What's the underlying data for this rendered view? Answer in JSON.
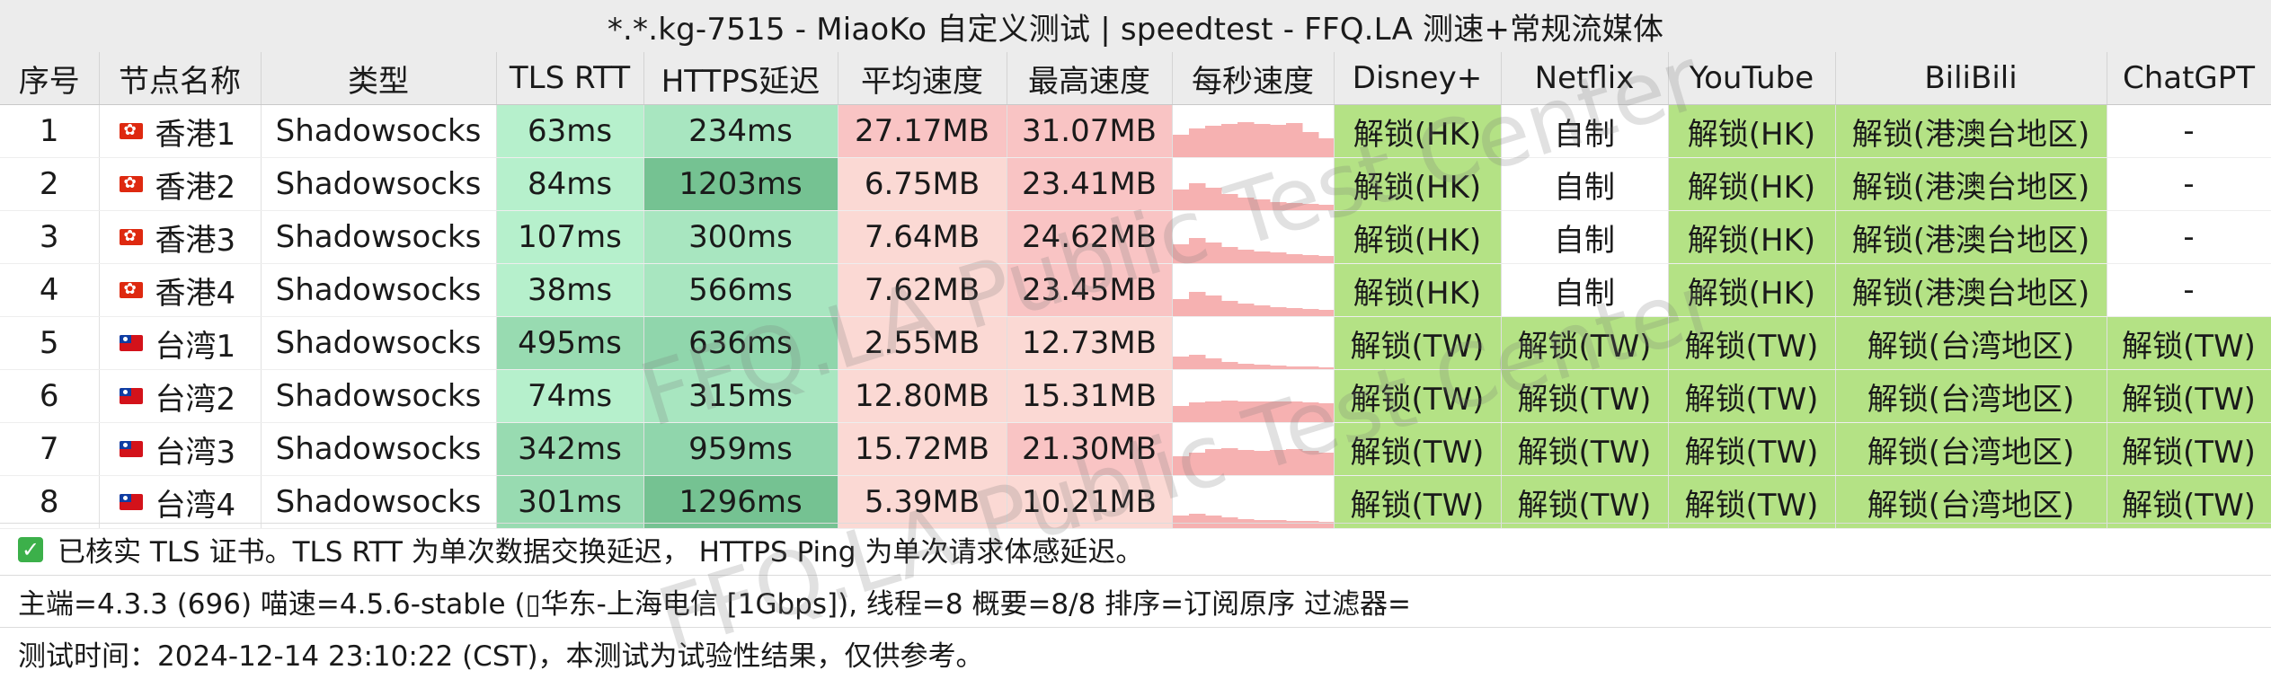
{
  "window": {
    "title": "*.*.kg-7515 - MiaoKo 自定义测试 | speedtest - FFQ.LA 测速+常规流媒体"
  },
  "table": {
    "columns": [
      "序号",
      "节点名称",
      "类型",
      "TLS RTT",
      "HTTPS延迟",
      "平均速度",
      "最高速度",
      "每秒速度",
      "Disney+",
      "Netflix",
      "YouTube",
      "BiliBili",
      "ChatGPT"
    ],
    "rows": [
      {
        "index": "1",
        "flag": "hk-flag-icon",
        "name": "香港1",
        "type": "Shadowsocks",
        "tls_rtt": "63ms",
        "https": "234ms",
        "avg": "27.17MB",
        "max": "31.07MB",
        "speed_trace": [
          0.55,
          0.7,
          0.75,
          0.8,
          0.85,
          0.8,
          0.78,
          0.82,
          0.6,
          0.45
        ],
        "disney": "解锁(HK)",
        "netflix": "自制",
        "youtube": "解锁(HK)",
        "bilibili": "解锁(港澳台地区)",
        "chatgpt": "-"
      },
      {
        "index": "2",
        "flag": "hk-flag-icon",
        "name": "香港2",
        "type": "Shadowsocks",
        "tls_rtt": "84ms",
        "https": "1203ms",
        "avg": "6.75MB",
        "max": "23.41MB",
        "speed_trace": [
          0.5,
          0.65,
          0.55,
          0.4,
          0.3,
          0.25,
          0.2,
          0.18,
          0.15,
          0.12
        ],
        "disney": "解锁(HK)",
        "netflix": "自制",
        "youtube": "解锁(HK)",
        "bilibili": "解锁(港澳台地区)",
        "chatgpt": "-"
      },
      {
        "index": "3",
        "flag": "hk-flag-icon",
        "name": "香港3",
        "type": "Shadowsocks",
        "tls_rtt": "107ms",
        "https": "300ms",
        "avg": "7.64MB",
        "max": "24.62MB",
        "speed_trace": [
          0.45,
          0.6,
          0.5,
          0.4,
          0.32,
          0.28,
          0.25,
          0.22,
          0.2,
          0.18
        ],
        "disney": "解锁(HK)",
        "netflix": "自制",
        "youtube": "解锁(HK)",
        "bilibili": "解锁(港澳台地区)",
        "chatgpt": "-"
      },
      {
        "index": "4",
        "flag": "hk-flag-icon",
        "name": "香港4",
        "type": "Shadowsocks",
        "tls_rtt": "38ms",
        "https": "566ms",
        "avg": "7.62MB",
        "max": "23.45MB",
        "speed_trace": [
          0.42,
          0.58,
          0.5,
          0.38,
          0.3,
          0.26,
          0.22,
          0.2,
          0.18,
          0.16
        ],
        "disney": "解锁(HK)",
        "netflix": "自制",
        "youtube": "解锁(HK)",
        "bilibili": "解锁(港澳台地区)",
        "chatgpt": "-"
      },
      {
        "index": "5",
        "flag": "tw-flag-icon",
        "name": "台湾1",
        "type": "Shadowsocks",
        "tls_rtt": "495ms",
        "https": "636ms",
        "avg": "2.55MB",
        "max": "12.73MB",
        "speed_trace": [
          0.3,
          0.35,
          0.25,
          0.18,
          0.12,
          0.1,
          0.08,
          0.07,
          0.06,
          0.05
        ],
        "disney": "解锁(TW)",
        "netflix": "解锁(TW)",
        "youtube": "解锁(TW)",
        "bilibili": "解锁(台湾地区)",
        "chatgpt": "解锁(TW)"
      },
      {
        "index": "6",
        "flag": "tw-flag-icon",
        "name": "台湾2",
        "type": "Shadowsocks",
        "tls_rtt": "74ms",
        "https": "315ms",
        "avg": "12.80MB",
        "max": "15.31MB",
        "speed_trace": [
          0.4,
          0.48,
          0.5,
          0.52,
          0.5,
          0.49,
          0.51,
          0.5,
          0.48,
          0.46
        ],
        "disney": "解锁(TW)",
        "netflix": "解锁(TW)",
        "youtube": "解锁(TW)",
        "bilibili": "解锁(台湾地区)",
        "chatgpt": "解锁(TW)"
      },
      {
        "index": "7",
        "flag": "tw-flag-icon",
        "name": "台湾3",
        "type": "Shadowsocks",
        "tls_rtt": "342ms",
        "https": "959ms",
        "avg": "15.72MB",
        "max": "21.30MB",
        "speed_trace": [
          0.45,
          0.55,
          0.62,
          0.65,
          0.6,
          0.58,
          0.6,
          0.62,
          0.58,
          0.55
        ],
        "disney": "解锁(TW)",
        "netflix": "解锁(TW)",
        "youtube": "解锁(TW)",
        "bilibili": "解锁(台湾地区)",
        "chatgpt": "解锁(TW)"
      },
      {
        "index": "8",
        "flag": "tw-flag-icon",
        "name": "台湾4",
        "type": "Shadowsocks",
        "tls_rtt": "301ms",
        "https": "1296ms",
        "avg": "5.39MB",
        "max": "10.21MB",
        "speed_trace": [
          0.3,
          0.35,
          0.3,
          0.25,
          0.22,
          0.2,
          0.2,
          0.18,
          0.17,
          0.16
        ],
        "disney": "解锁(TW)",
        "netflix": "解锁(TW)",
        "youtube": "解锁(TW)",
        "bilibili": "解锁(台湾地区)",
        "chatgpt": "解锁(TW)"
      }
    ]
  },
  "footer": {
    "tls_note": "已核实 TLS 证书。TLS RTT 为单次数据交换延迟， HTTPS Ping 为单次请求体感延迟。",
    "info": "主端=4.3.3 (696) 喵速=4.5.6-stable (▯华东-上海电信 [1Gbps]), 线程=8 概要=8/8 排序=订阅原序 过滤器=",
    "time": "测试时间：2024-12-14 23:10:22 (CST)，本测试为试验性结果，仅供参考。"
  },
  "watermark": {
    "text": "FFQ.LA Public Test Center"
  },
  "colors": {
    "header_bg": "#ececec",
    "unlock_green": "#b4e285",
    "tls_green": "#b6f0cc",
    "tls_green_slow": "#98dbb1",
    "https_green": "#a8e6c0",
    "https_green_mid": "#90d6ac",
    "https_green_slow": "#75c292",
    "speed_pink": "#f9c4c4",
    "speed_pink_light": "#fbd9d4",
    "spark_fill": "#f6b1b1"
  }
}
